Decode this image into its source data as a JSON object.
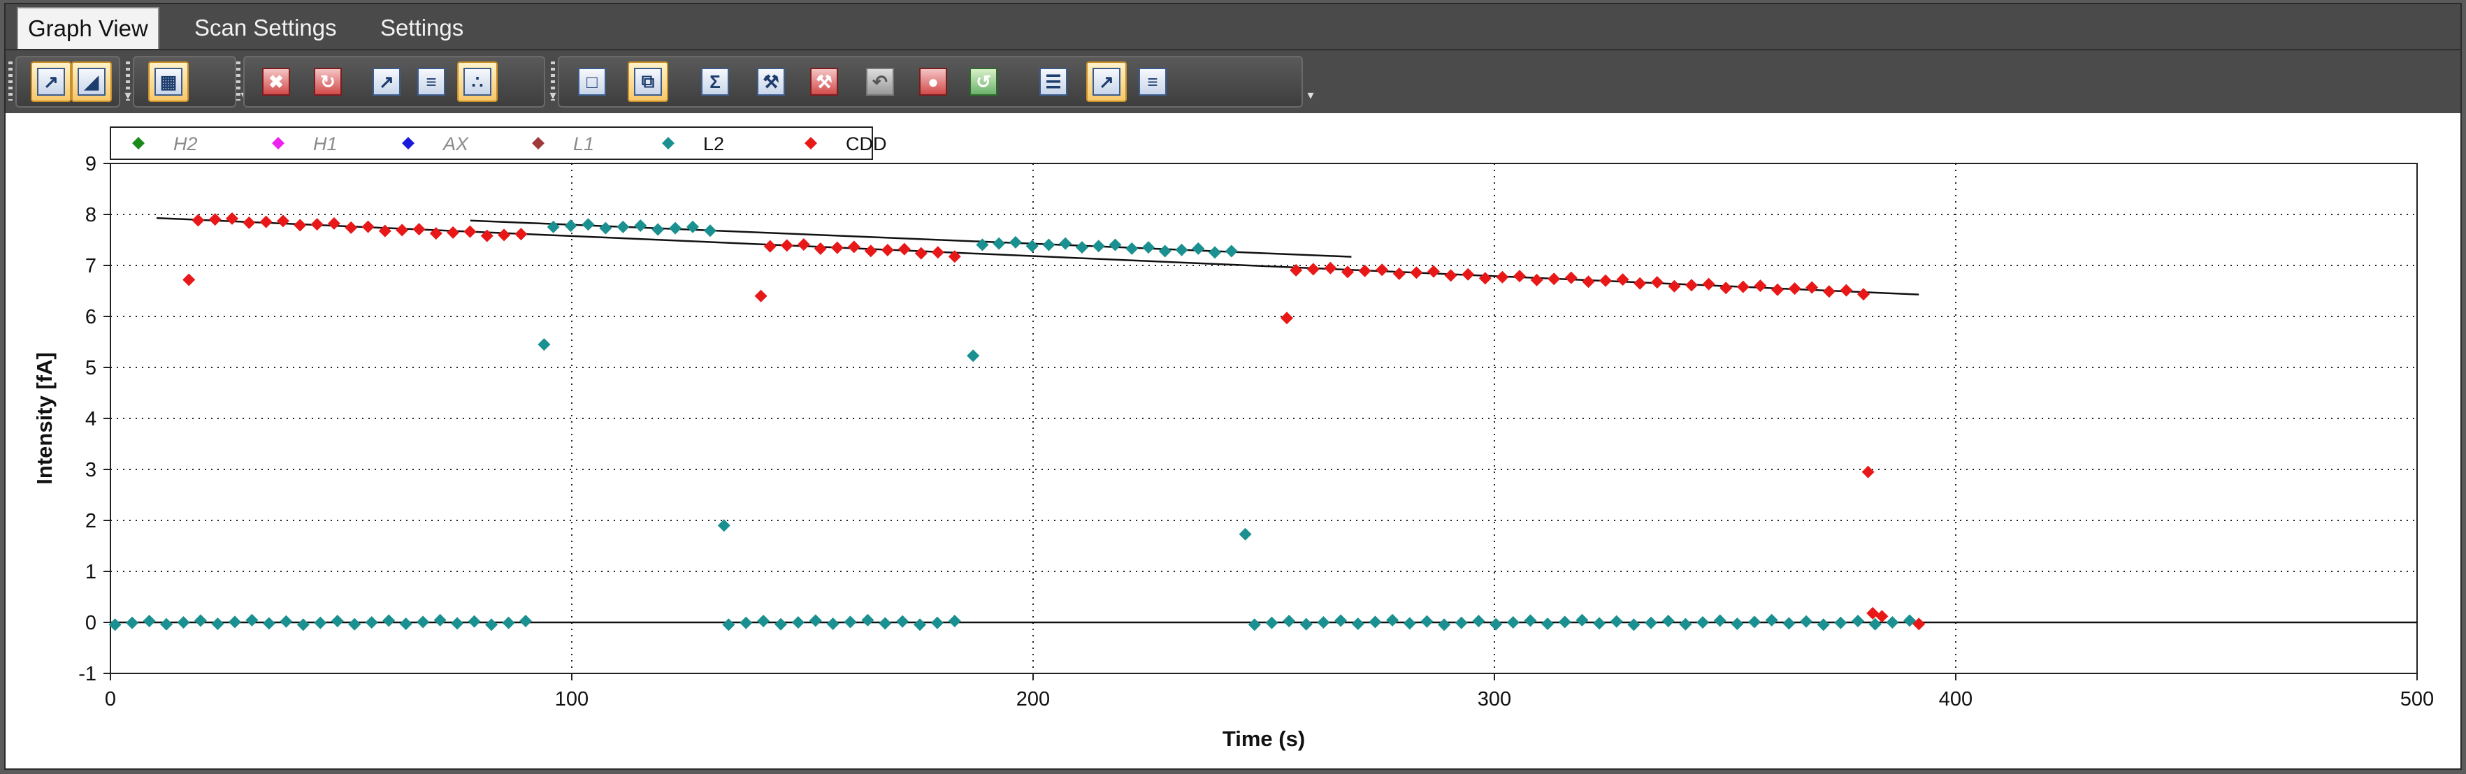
{
  "tabs": [
    {
      "label": "Graph View",
      "active": true
    },
    {
      "label": "Scan Settings",
      "active": false
    },
    {
      "label": "Settings",
      "active": false
    }
  ],
  "toolbar": {
    "buttons": [
      {
        "icon": "graph-icon",
        "on": true,
        "group": 1
      },
      {
        "icon": "graph-fill-icon",
        "on": true,
        "group": 1
      },
      {
        "icon": "grid-icon",
        "on": true,
        "group": 2
      },
      {
        "icon": "delete-icon",
        "on": false,
        "group": 3
      },
      {
        "icon": "refresh-icon",
        "on": false,
        "group": 3
      },
      {
        "icon": "chart-icon",
        "on": false,
        "group": 3
      },
      {
        "icon": "list-icon",
        "on": false,
        "group": 3
      },
      {
        "icon": "scatter-icon",
        "on": true,
        "group": 3
      },
      {
        "icon": "window-icon",
        "on": false,
        "group": 4
      },
      {
        "icon": "windows-icon",
        "on": true,
        "group": 4
      },
      {
        "icon": "sum-icon",
        "on": false,
        "group": 4
      },
      {
        "icon": "wrench-icon",
        "on": false,
        "group": 4
      },
      {
        "icon": "wrench-remove-icon",
        "on": false,
        "group": 4
      },
      {
        "icon": "undo-icon",
        "on": false,
        "group": 4
      },
      {
        "icon": "record-icon",
        "on": false,
        "group": 4
      },
      {
        "icon": "sync-icon",
        "on": false,
        "group": 4
      },
      {
        "icon": "table-icon",
        "on": false,
        "group": 4
      },
      {
        "icon": "graph-icon",
        "on": true,
        "group": 4
      },
      {
        "icon": "list-icon",
        "on": false,
        "group": 4
      },
      {
        "icon": "scatter-icon",
        "on": false,
        "group": 4
      }
    ]
  },
  "chart_data": {
    "type": "scatter",
    "xlabel": "Time (s)",
    "ylabel": "Intensity [fA]",
    "xlim": [
      0,
      500
    ],
    "ylim": [
      -1,
      9
    ],
    "xticks": [
      "0",
      "100",
      "200",
      "300",
      "400",
      "500"
    ],
    "yticks": [
      "-1",
      "0",
      "1",
      "2",
      "3",
      "4",
      "5",
      "6",
      "7",
      "8",
      "9"
    ],
    "grid": true,
    "legend_position": "top-left",
    "legend": [
      {
        "name": "H2",
        "color": "#1a8a1a",
        "enabled": false
      },
      {
        "name": "H1",
        "color": "#ee22ee",
        "enabled": false
      },
      {
        "name": "AX",
        "color": "#1a1add",
        "enabled": false
      },
      {
        "name": "L1",
        "color": "#9e3a3a",
        "enabled": false
      },
      {
        "name": "L2",
        "color": "#1a9090",
        "enabled": true
      },
      {
        "name": "CDD",
        "color": "#e81818",
        "enabled": true
      }
    ],
    "series": [
      {
        "name": "CDD",
        "color": "#e81818",
        "segments": [
          {
            "x": [
              19,
              89
            ],
            "y": [
              7.93,
              7.57
            ]
          },
          {
            "x": [
              143,
              183
            ],
            "y": [
              7.42,
              7.22
            ]
          },
          {
            "x": [
              257,
              380
            ],
            "y": [
              6.95,
              6.48
            ]
          }
        ],
        "outliers": [
          {
            "x": 17,
            "y": 6.72
          },
          {
            "x": 141,
            "y": 6.4
          },
          {
            "x": 255,
            "y": 5.97
          },
          {
            "x": 381,
            "y": 2.95
          },
          {
            "x": 382,
            "y": 0.18
          },
          {
            "x": 384,
            "y": 0.12
          },
          {
            "x": 392,
            "y": -0.03
          }
        ]
      },
      {
        "name": "L2",
        "color": "#1a9090",
        "segments": [
          {
            "x": [
              96,
              130
            ],
            "y": [
              7.8,
              7.7
            ]
          },
          {
            "x": [
              189,
              243
            ],
            "y": [
              7.45,
              7.28
            ]
          },
          {
            "x": [
              1,
              90
            ],
            "y": [
              0.0,
              0.0
            ]
          },
          {
            "x": [
              134,
              183
            ],
            "y": [
              0.0,
              0.0
            ]
          },
          {
            "x": [
              248,
              390
            ],
            "y": [
              0.0,
              0.0
            ]
          }
        ],
        "outliers": [
          {
            "x": 94,
            "y": 5.45
          },
          {
            "x": 133,
            "y": 1.9
          },
          {
            "x": 187,
            "y": 5.23
          },
          {
            "x": 246,
            "y": 1.73
          }
        ]
      }
    ],
    "fit_lines": [
      {
        "x": [
          10,
          392
        ],
        "y": [
          7.93,
          6.43
        ]
      },
      {
        "x": [
          78,
          269
        ],
        "y": [
          7.88,
          7.17
        ]
      },
      {
        "x": [
          0,
          500
        ],
        "y": [
          0.0,
          0.0
        ]
      }
    ]
  }
}
